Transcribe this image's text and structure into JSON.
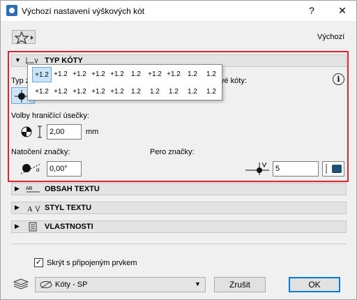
{
  "window": {
    "title": "Výchozí nastavení výškových kót",
    "help": "?",
    "close": "✕"
  },
  "toolbar": {
    "favorites_icon": "star-icon",
    "default_label": "Výchozí"
  },
  "sections": {
    "typ_koty": {
      "label": "TYP KÓTY"
    },
    "obsah_textu": {
      "label": "OBSAH TEXTU"
    },
    "styl_textu": {
      "label": "STYL TEXTU"
    },
    "vlastnosti": {
      "label": "VLASTNOSTI"
    }
  },
  "typ": {
    "type_label_partial": "Typ zn",
    "right_label_partial": "vé kóty:",
    "volby_label": "Volby hraničící úsečky:",
    "size_value": "2,00",
    "size_unit": "mm",
    "natoceni_label": "Natočení značky:",
    "angle_value": "0,00°",
    "pero_label": "Pero značky:",
    "pen_value": "5",
    "pen_color": "#1d4f73",
    "marker_options": [
      "+1.2",
      "+1.2",
      "+1.2",
      "+1.2",
      "+1.2",
      "1.2",
      "+1.2",
      "+1.2",
      "1.2",
      "1.2",
      "+1.2",
      "+1.2",
      "+1.2",
      "+1.2",
      "+1.2",
      "1.2",
      "1.2",
      "1.2",
      "1.2",
      "1.2"
    ]
  },
  "footer": {
    "hide_label": "Skrýt s připojeným prvkem",
    "layer_value": "Kóty - SP",
    "cancel_label": "Zrušit",
    "ok_label": "OK"
  }
}
